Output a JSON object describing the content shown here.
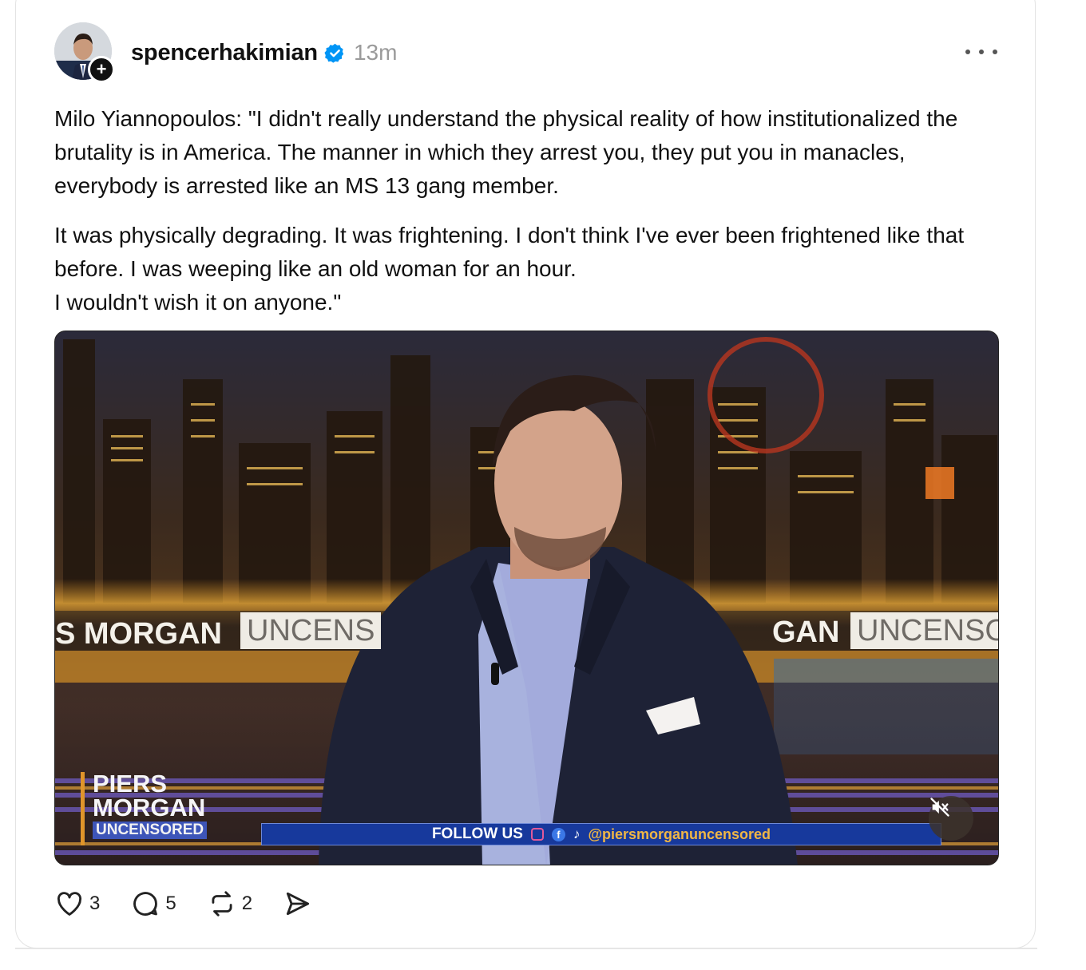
{
  "post": {
    "username": "spencerhakimian",
    "verified": true,
    "time": "13m",
    "paragraphs": [
      "Milo Yiannopoulos: \"I didn't really understand the physical reality of how institutionalized the brutality is in America. The manner in which they arrest you, they put you in manacles, everybody is arrested like an MS 13 gang member.",
      "It was physically degrading. It was frightening. I don't think I've ever been frightened like that before. I was weeping like an old woman for an hour.",
      "I wouldn't wish it on anyone.\""
    ]
  },
  "video": {
    "banner_left_a": "S MORGAN",
    "banner_left_b": "UNCENS",
    "banner_right_a": "GAN",
    "banner_right_b": "UNCENSO",
    "logo_line1": "PIERS",
    "logo_line2": "MORGAN",
    "logo_line3": "UNCENSORED",
    "follow_label": "FOLLOW US",
    "handle": "@piersmorganuncensored",
    "muted": true
  },
  "actions": {
    "likes": "3",
    "replies": "5",
    "reposts": "2"
  },
  "icons": {
    "verified": "verified-badge-icon",
    "more": "more-icon",
    "like": "heart-icon",
    "reply": "comment-icon",
    "repost": "repost-icon",
    "share": "send-icon",
    "mute": "muted-speaker-icon",
    "follow": "plus-icon"
  },
  "colors": {
    "verified_blue": "#0095f6",
    "text": "#111111",
    "muted_text": "#9a9a9a"
  }
}
